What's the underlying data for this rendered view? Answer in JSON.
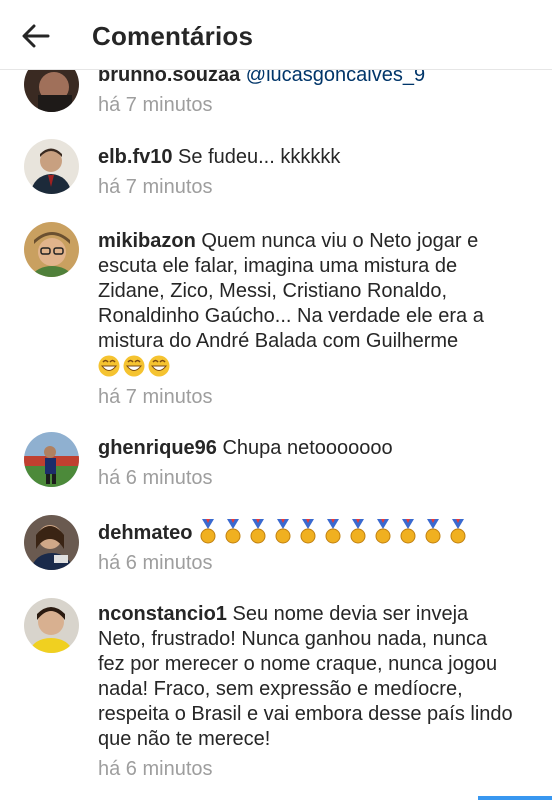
{
  "header": {
    "title": "Comentários",
    "back_icon": "arrow-left-icon"
  },
  "comments": [
    {
      "username": "brunno.souzaa",
      "mention": "@lucasgoncalves_9",
      "text": "",
      "time": "há 7 minutos"
    },
    {
      "username": "elb.fv10",
      "text": "Se fudeu... kkkkkk",
      "time": "há 7 minutos"
    },
    {
      "username": "mikibazon",
      "text": "Quem nunca viu o Neto jogar e escuta ele falar, imagina uma mistura de Zidane, Zico, Messi, Cristiano Ronaldo, Ronaldinho Gaúcho... Na verdade ele era a mistura do André Balada com Guilherme",
      "emoji": "😁😁😁",
      "time": "há 7 minutos"
    },
    {
      "username": "ghenrique96",
      "text": "Chupa netooooooo",
      "time": "há 6 minutos"
    },
    {
      "username": "dehmateo",
      "medal_count": 11,
      "time": "há 6 minutos"
    },
    {
      "username": "nconstancio1",
      "text": "Seu nome devia ser inveja Neto, frustrado! Nunca ganhou nada, nunca fez por merecer o nome craque, nunca jogou nada! Fraco, sem expressão e medíocre, respeita o Brasil e vai embora desse país lindo que não te merece!",
      "time": "há 6 minutos"
    }
  ],
  "colors": {
    "mention": "#003569",
    "timestamp": "#9e9e9e",
    "accent": "#3897f0"
  }
}
